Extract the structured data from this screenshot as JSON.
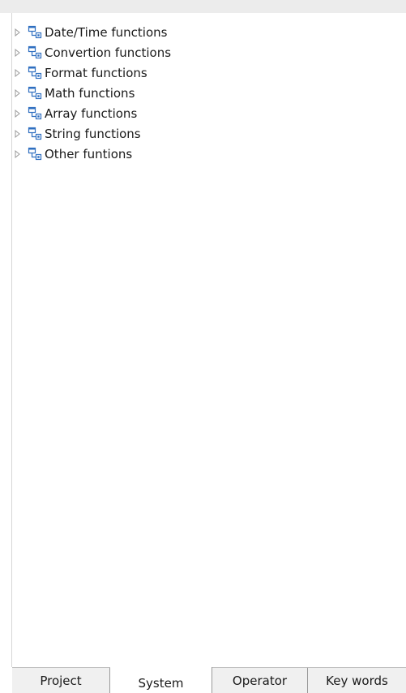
{
  "tree": {
    "items": [
      {
        "label": "Date/Time functions",
        "icon": "function-group-icon"
      },
      {
        "label": "Convertion functions",
        "icon": "function-group-icon"
      },
      {
        "label": "Format functions",
        "icon": "function-group-icon"
      },
      {
        "label": "Math functions",
        "icon": "function-group-icon"
      },
      {
        "label": "Array functions",
        "icon": "function-group-icon"
      },
      {
        "label": "String functions",
        "icon": "function-group-icon"
      },
      {
        "label": "Other funtions",
        "icon": "function-group-icon"
      }
    ]
  },
  "tabs": {
    "items": [
      {
        "label": "Project",
        "active": false
      },
      {
        "label": "System",
        "active": true
      },
      {
        "label": "Operator",
        "active": false
      },
      {
        "label": "Key words",
        "active": false
      }
    ]
  },
  "colors": {
    "icon_blue": "#2f6fc0",
    "expander_gray": "#9a9a9a",
    "tab_border": "#9a9a9a"
  }
}
